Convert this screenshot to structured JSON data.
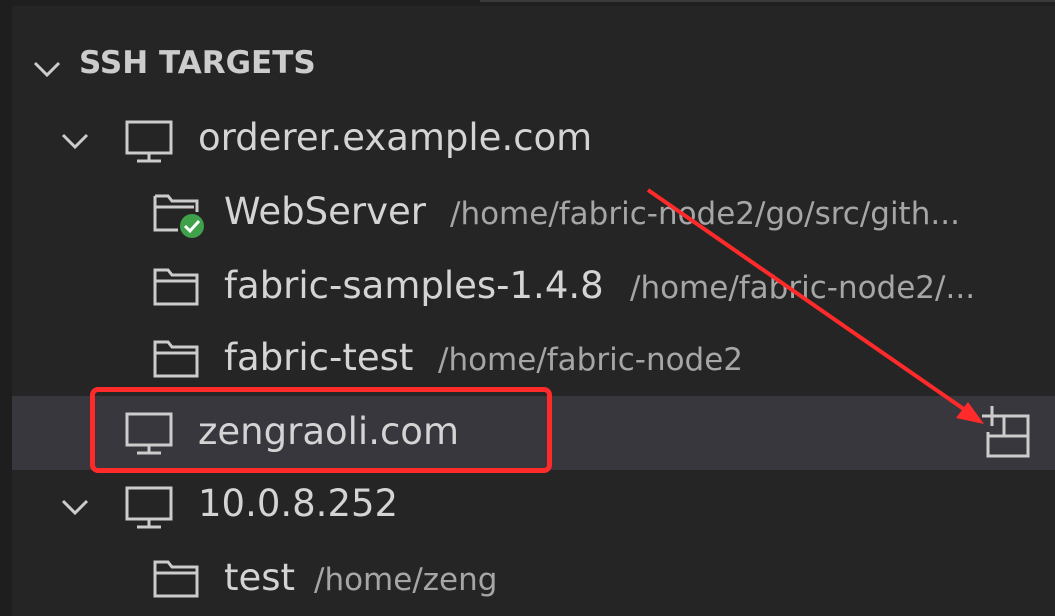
{
  "section": {
    "title": "SSH TARGETS",
    "chevron_icon": "chevron-down-icon"
  },
  "hosts": [
    {
      "name": "orderer.example.com",
      "icon": "monitor-icon",
      "expanded": true,
      "folders": [
        {
          "name": "WebServer",
          "path": "/home/fabric-node2/go/src/gith...",
          "icon": "folder-connected-icon"
        },
        {
          "name": "fabric-samples-1.4.8",
          "path": "/home/fabric-node2/...",
          "icon": "folder-icon"
        },
        {
          "name": "fabric-test",
          "path": "/home/fabric-node2",
          "icon": "folder-icon"
        }
      ]
    },
    {
      "name": "zengraoli.com",
      "icon": "monitor-icon",
      "expanded": false,
      "selected": true,
      "action_icon": "open-in-new-window-icon"
    },
    {
      "name": "10.0.8.252",
      "icon": "monitor-icon",
      "expanded": true,
      "folders": [
        {
          "name": "test",
          "path": "/home/zeng",
          "icon": "folder-icon"
        }
      ]
    }
  ],
  "colors": {
    "background": "#252526",
    "selected_row": "#37373d",
    "text": "#d4d4d4",
    "path_text": "#a6a6a6",
    "annotation": "#ff2a2a",
    "connected_badge": "#3fa14a"
  }
}
